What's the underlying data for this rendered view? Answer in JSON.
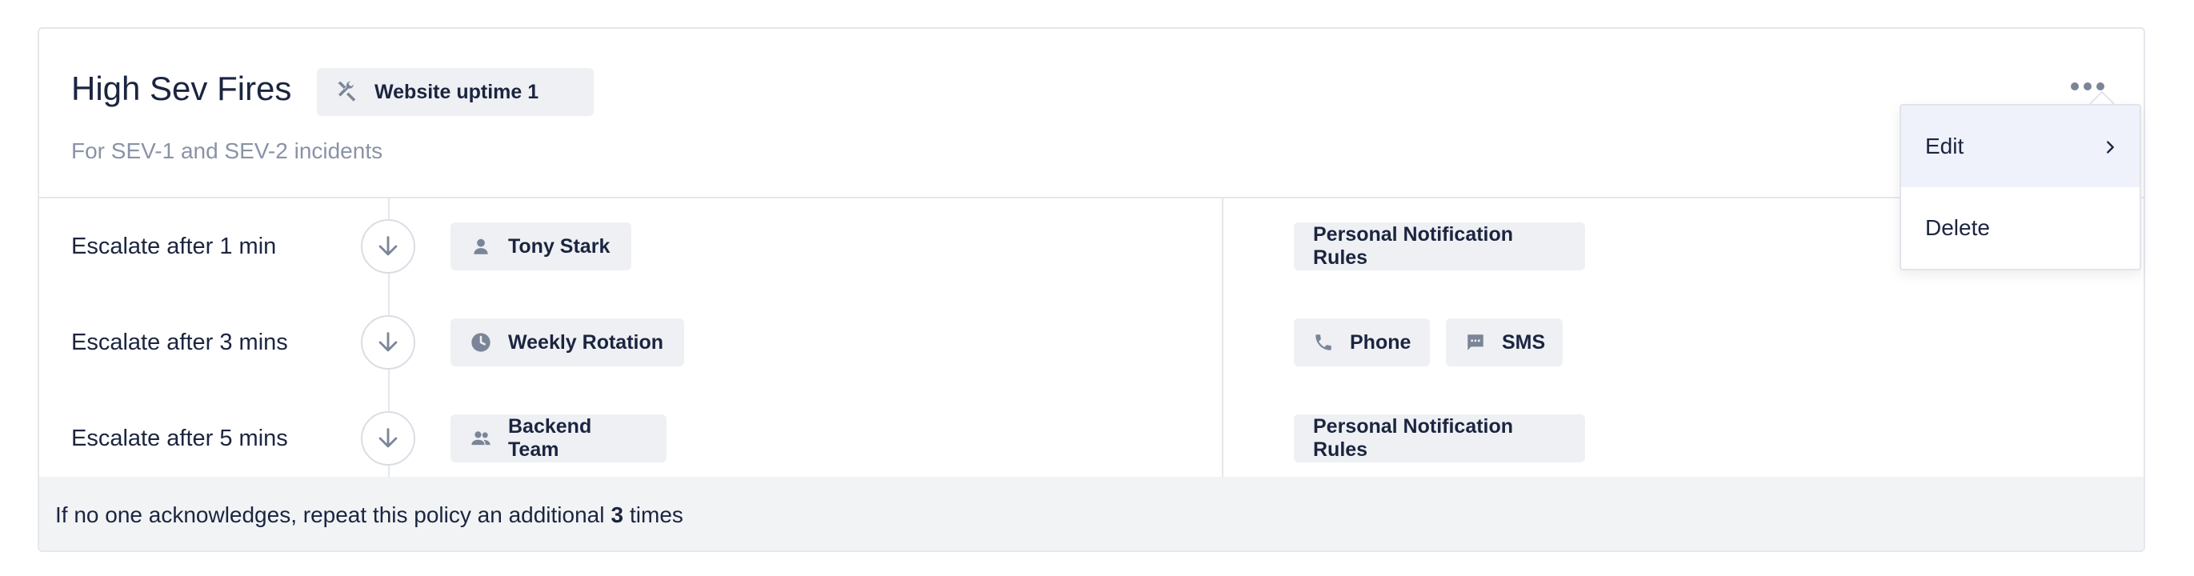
{
  "policy": {
    "title": "High Sev Fires",
    "service_chip": {
      "label": "Website uptime 1",
      "icon": "tools-icon"
    },
    "subtitle": "For SEV-1 and SEV-2 incidents"
  },
  "steps": [
    {
      "escalate_label": "Escalate after 1 min",
      "target": {
        "label": "Tony Stark",
        "icon": "user-icon"
      },
      "notifications": [
        {
          "label": "Personal Notification Rules"
        }
      ]
    },
    {
      "escalate_label": "Escalate after 3 mins",
      "target": {
        "label": "Weekly Rotation",
        "icon": "clock-icon"
      },
      "notifications": [
        {
          "label": "Phone",
          "icon": "phone-icon"
        },
        {
          "label": "SMS",
          "icon": "sms-icon"
        }
      ]
    },
    {
      "escalate_label": "Escalate after 5 mins",
      "target": {
        "label": "Backend Team",
        "icon": "team-icon"
      },
      "notifications": [
        {
          "label": "Personal Notification Rules"
        }
      ]
    }
  ],
  "footer": {
    "prefix": "If no one acknowledges, repeat this policy an additional",
    "count": "3",
    "suffix": "times"
  },
  "menu": {
    "items": [
      {
        "label": "Edit",
        "has_submenu": true
      },
      {
        "label": "Delete"
      }
    ]
  },
  "colors": {
    "text": "#1b2540",
    "muted": "#8a93a5",
    "chip_bg": "#eef0f3",
    "icon": "#7b8598",
    "menu_active": "#eff2fb"
  }
}
